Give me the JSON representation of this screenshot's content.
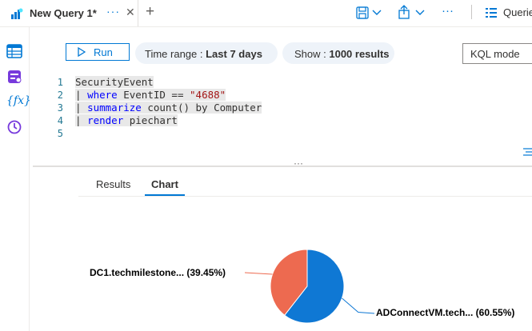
{
  "tab": {
    "title": "New Query 1*",
    "more": "···",
    "close": "✕",
    "new_tab": "+"
  },
  "header": {
    "queries_label": "Querie",
    "more": "···"
  },
  "toolbar": {
    "run_label": "Run",
    "time_range_prefix": "Time range : ",
    "time_range_value": "Last 7 days",
    "show_prefix": "Show : ",
    "show_value": "1000 results",
    "mode_label": "KQL mode"
  },
  "editor": {
    "line_numbers": [
      "1",
      "2",
      "3",
      "4",
      "5"
    ],
    "lines": {
      "l1": "SecurityEvent",
      "l2_pipe": "| ",
      "l2_kw": "where",
      "l2_mid": " EventID == ",
      "l2_str": "\"4688\"",
      "l3_pipe": "| ",
      "l3_kw": "summarize",
      "l3_rest": " count() by Computer",
      "l4_pipe": "| ",
      "l4_kw": "render",
      "l4_rest": " piechart"
    }
  },
  "splitter_handle": "···",
  "results_tabs": [
    "Results",
    "Chart"
  ],
  "active_results_tab": "Chart",
  "colors": {
    "accent": "#0078d4",
    "slice_1": "#0f78d4",
    "slice_2": "#ed6a50"
  },
  "chart_data": {
    "type": "pie",
    "slices": [
      {
        "label": "ADConnectVM.tech... (60.55%)",
        "value": 60.55,
        "color": "#0f78d4"
      },
      {
        "label": "DC1.techmilestone... (39.45%)",
        "value": 39.45,
        "color": "#ed6a50"
      }
    ]
  }
}
